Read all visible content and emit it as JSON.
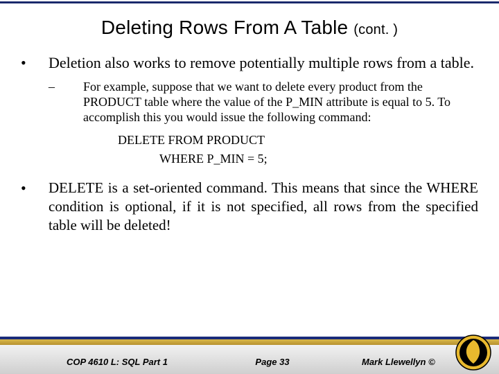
{
  "title": {
    "main": "Deleting Rows From A Table ",
    "cont": "(cont. )"
  },
  "bullets": {
    "b1": "Deletion also works to remove potentially multiple rows from a table.",
    "sub1": "For example, suppose that we want to delete every product from the PRODUCT table where the value of the P_MIN attribute is equal to 5.  To accomplish this you would issue the following command:",
    "code_line1": "DELETE FROM PRODUCT",
    "code_line2": "WHERE P_MIN = 5;",
    "b2": "DELETE is a set-oriented command.  This means that since the WHERE condition is optional, if it is not specified, all rows from the specified table will be deleted!"
  },
  "footer": {
    "left": "COP 4610 L: SQL Part 1",
    "center": "Page 33",
    "right": "Mark Llewellyn ©"
  },
  "colors": {
    "navy": "#1a2b7a",
    "gold": "#c9a227"
  }
}
